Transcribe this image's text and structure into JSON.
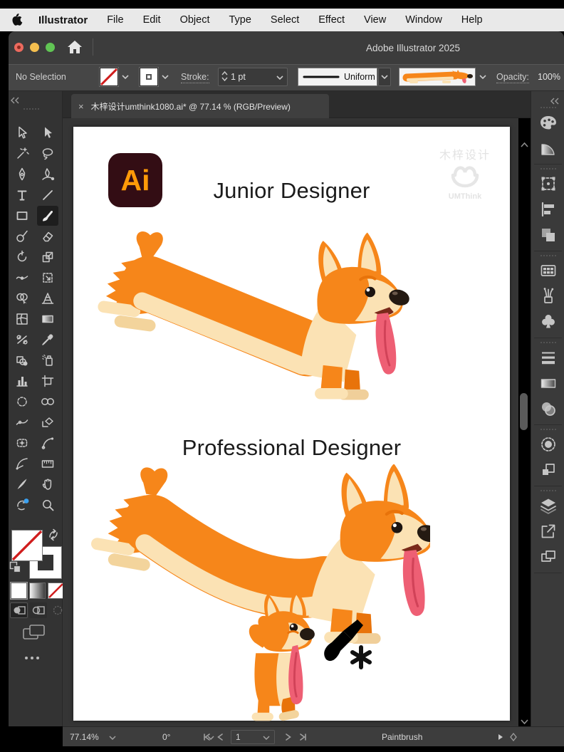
{
  "menubar": {
    "items": [
      "Illustrator",
      "File",
      "Edit",
      "Object",
      "Type",
      "Select",
      "Effect",
      "View",
      "Window",
      "Help"
    ]
  },
  "titlebar": {
    "title": "Adobe Illustrator 2025"
  },
  "control_bar": {
    "selection_status": "No Selection",
    "stroke_label": "Stroke:",
    "stroke_value": "1 pt",
    "variable_width_profile": "Uniform",
    "opacity_label": "Opacity:",
    "opacity_value": "100%"
  },
  "document_tab": {
    "close": "×",
    "title": "木梓设计umthink1080.ai* @ 77.14 % (RGB/Preview)"
  },
  "toolbar": {
    "selected_tool": "Paintbrush",
    "tools": [
      "Selection",
      "Direct Selection",
      "Magic Wand",
      "Lasso",
      "Pen",
      "Curvature",
      "Type",
      "Line Segment",
      "Rectangle",
      "Paintbrush",
      "Shaper",
      "Eraser",
      "Rotate",
      "Scale",
      "Width",
      "Free Transform",
      "Shape Builder",
      "Perspective Grid",
      "Mesh",
      "Gradient",
      "Blend",
      "Eyedropper",
      "Symbol Shifter",
      "Symbol Sprayer",
      "Column Graph",
      "Artboard",
      "Slice",
      "Slice Selection",
      "Smooth",
      "Reshape",
      "Puppet Warp",
      "Arc",
      "Curve",
      "Measure",
      "Knife",
      "Hand",
      "Rotate View",
      "Zoom"
    ]
  },
  "right_panel": {
    "icons": [
      "Color",
      "Gradient Tool",
      "Transform",
      "Align",
      "Pathfinder",
      "Swatches",
      "Brushes",
      "Symbols",
      "Stroke",
      "Gradient",
      "Transparency",
      "Appearance",
      "Graphic Styles",
      "Layers",
      "Asset Export",
      "Artboards"
    ]
  },
  "artboard": {
    "junior_title": "Junior Designer",
    "professional_title": "Professional Designer",
    "ai_badge": "Ai",
    "watermark_cn": "木梓设计",
    "watermark_en": "UMThink"
  },
  "status_bar": {
    "zoom": "77.14%",
    "rotation": "0°",
    "page": "1",
    "tool": "Paintbrush"
  },
  "colors": {
    "corgi_orange": "#f6861a",
    "corgi_cream": "#fbe2b4",
    "tongue": "#ee5f74",
    "ai_badge_bg": "#330d14",
    "ai_badge_fg": "#ff9a08",
    "notification_blue": "#3aa0f0"
  }
}
